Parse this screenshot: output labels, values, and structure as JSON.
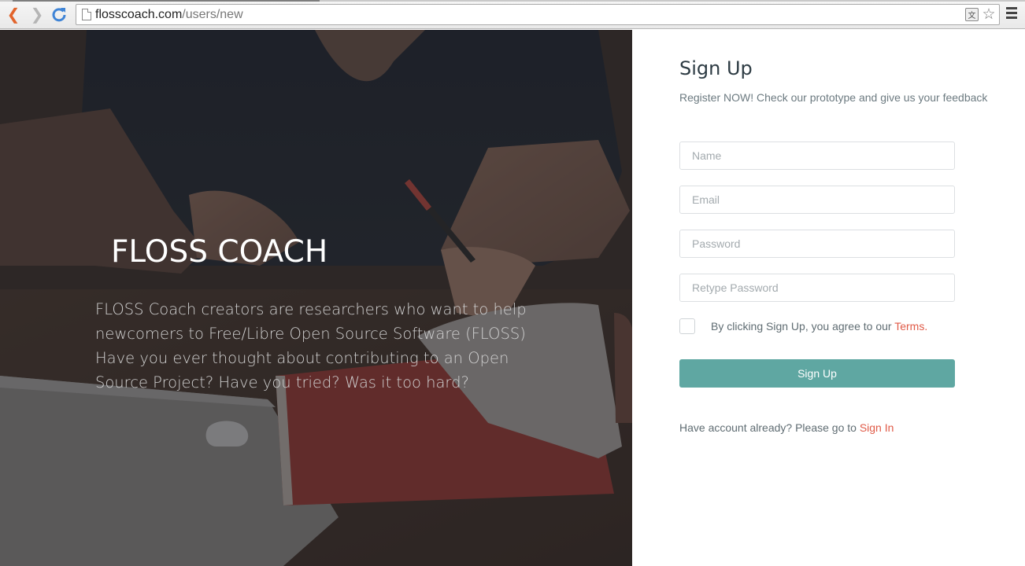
{
  "browser": {
    "url_host": "flosscoach.com",
    "url_path": "/users/new",
    "icons": [
      "back-icon",
      "forward-icon",
      "reload-icon",
      "page-icon",
      "translate-icon",
      "star-icon",
      "menu-icon"
    ]
  },
  "hero": {
    "title": "FLOSS COACH",
    "description": "FLOSS Coach creators are researchers who want to help newcomers to Free/Libre Open Source Software (FLOSS) Have you ever thought about contributing to an Open Source Project? Have you tried? Was it too hard?"
  },
  "form": {
    "title": "Sign Up",
    "subtitle": "Register NOW! Check our prototype and give us your feedback",
    "name_placeholder": "Name",
    "email_placeholder": "Email",
    "password_placeholder": "Password",
    "retype_password_placeholder": "Retype Password",
    "terms_text": "By clicking Sign Up, you agree to our ",
    "terms_link": "Terms",
    "terms_suffix": ".",
    "submit_label": "Sign Up",
    "signin_text": "Have account already? Please go to ",
    "signin_link": "Sign In"
  },
  "colors": {
    "accent": "#5fa7a2",
    "link": "#e05a47",
    "title": "#2d3b43"
  }
}
